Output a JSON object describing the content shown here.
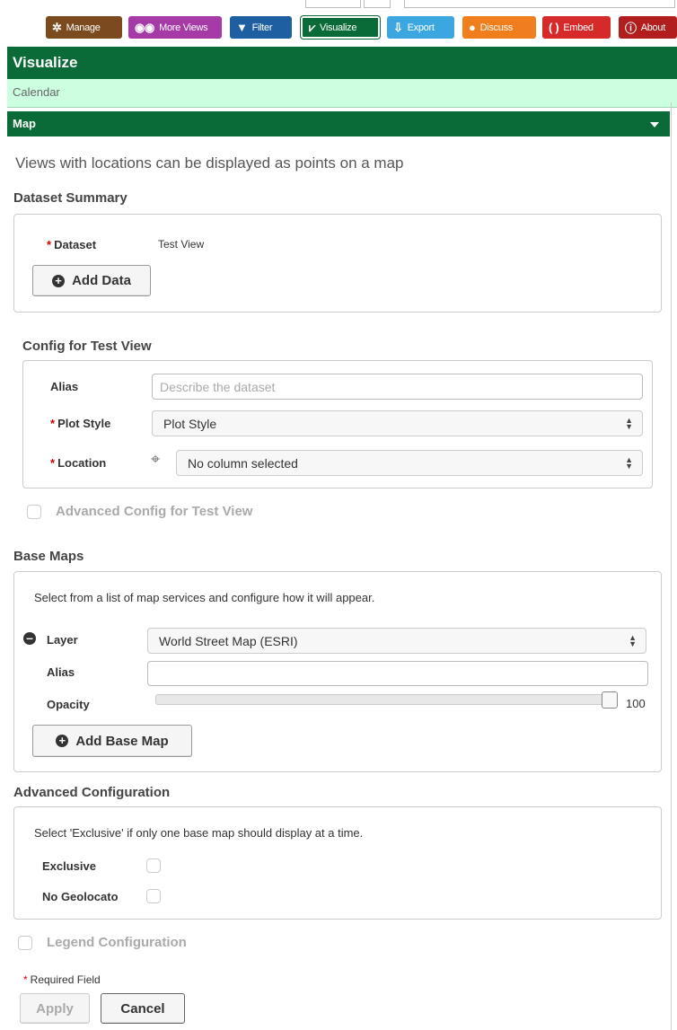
{
  "toolbar": {
    "buttons": [
      {
        "label": "Manage",
        "icon": "gear-icon",
        "color": "#7b4a1e"
      },
      {
        "label": "More Views",
        "icon": "binoculars-icon",
        "color": "#a63aa6"
      },
      {
        "label": "Filter",
        "icon": "funnel-icon",
        "color": "#1d5fa1"
      },
      {
        "label": "Visualize",
        "icon": "chart-icon",
        "color": "#0b6b38"
      },
      {
        "label": "Export",
        "icon": "export-icon",
        "color": "#3ba6e0"
      },
      {
        "label": "Discuss",
        "icon": "speech-bubble-icon",
        "color": "#f07e1c"
      },
      {
        "label": "Embed",
        "icon": "brackets-icon",
        "color": "#d62a2a"
      },
      {
        "label": "About",
        "icon": "info-icon",
        "color": "#b21e1e"
      }
    ]
  },
  "panel": {
    "title": "Visualize"
  },
  "views": {
    "calendar": "Calendar",
    "map": "Map"
  },
  "description": "Views with locations can be displayed as points on a map",
  "dataset_summary": {
    "title": "Dataset Summary",
    "dataset_label": "Dataset",
    "dataset_value": "Test View",
    "add_data_label": "Add Data"
  },
  "config": {
    "title": "Config for Test View",
    "alias_label": "Alias",
    "alias_placeholder": "Describe the dataset",
    "plot_style_label": "Plot Style",
    "plot_style_value": "Plot Style",
    "location_label": "Location",
    "location_value": "No column selected",
    "advanced_label": "Advanced Config for Test View"
  },
  "base_maps": {
    "title": "Base Maps",
    "description": "Select from a list of map services and configure how it will appear.",
    "layer_label": "Layer",
    "layer_value": "World Street Map (ESRI)",
    "alias_label": "Alias",
    "alias_value": "",
    "opacity_label": "Opacity",
    "opacity_value": "100",
    "add_label": "Add Base Map"
  },
  "advanced": {
    "title": "Advanced Configuration",
    "description": "Select 'Exclusive' if only one base map should display at a time.",
    "exclusive_label": "Exclusive",
    "no_geolocate_label": "No Geolocato"
  },
  "legend": {
    "label": "Legend Configuration"
  },
  "footer": {
    "required_label": "Required Field",
    "apply_label": "Apply",
    "cancel_label": "Cancel"
  }
}
